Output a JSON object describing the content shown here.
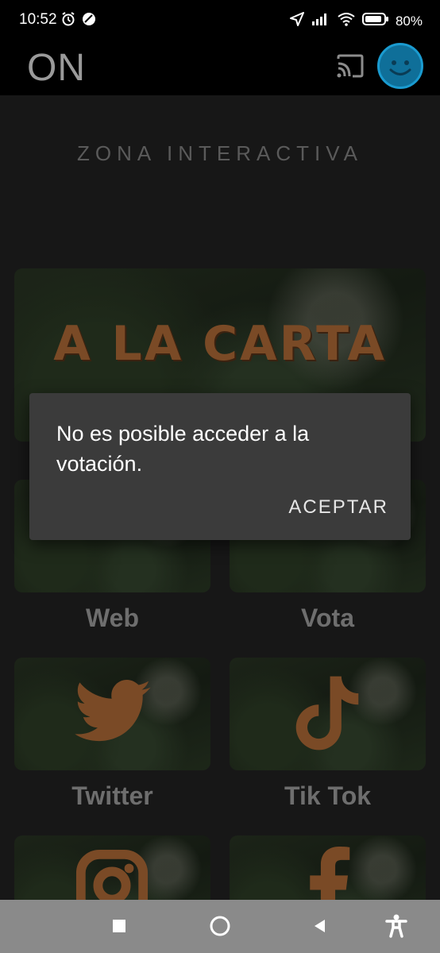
{
  "status_bar": {
    "time": "10:52",
    "battery": "80%"
  },
  "app_bar": {
    "logo": "ON"
  },
  "page": {
    "section_title": "ZONA INTERACTIVA"
  },
  "banner": {
    "title": "A LA CARTA"
  },
  "tiles": [
    {
      "label": "Web"
    },
    {
      "label": "Vota"
    },
    {
      "label": "Twitter"
    },
    {
      "label": "Tik Tok"
    }
  ],
  "dialog": {
    "message": "No es posible acceder a la votación.",
    "button": "ACEPTAR"
  },
  "icons": {
    "status_left": [
      "alarm-icon",
      "app-notification-icon"
    ],
    "status_right": [
      "location-icon",
      "signal-icon",
      "wifi-icon",
      "battery-icon"
    ],
    "app_bar": [
      "cast-icon",
      "avatar-smiley-icon"
    ],
    "tiles": [
      "twitter-icon",
      "tiktok-icon",
      "instagram-icon",
      "facebook-icon"
    ],
    "nav": [
      "recents-icon",
      "home-icon",
      "back-icon",
      "accessibility-icon"
    ]
  },
  "colors": {
    "accent": "#1a9bd0",
    "tile_art": "#8b5a2b",
    "dialog_bg": "#3b3b3b"
  }
}
